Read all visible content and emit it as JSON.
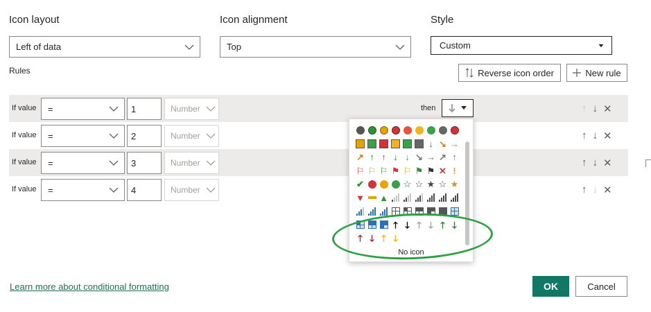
{
  "header": {
    "icon_layout_label": "Icon layout",
    "icon_layout_value": "Left of data",
    "icon_alignment_label": "Icon alignment",
    "icon_alignment_value": "Top",
    "style_label": "Style",
    "style_value": "Custom"
  },
  "rules": {
    "label": "Rules",
    "reverse_label": "Reverse icon order",
    "new_rule_label": "New rule",
    "items": [
      {
        "if_label": "If value",
        "operator": "=",
        "value": "1",
        "type": "Number",
        "then": "then"
      },
      {
        "if_label": "If value",
        "operator": "=",
        "value": "2",
        "type": "Number"
      },
      {
        "if_label": "If value",
        "operator": "=",
        "value": "3",
        "type": "Number"
      },
      {
        "if_label": "If value",
        "operator": "=",
        "value": "4",
        "type": "Number"
      }
    ]
  },
  "icon_picker": {
    "no_icon_label": "No icon"
  },
  "footer": {
    "learn_more": "Learn more about conditional formatting",
    "ok_label": "OK",
    "cancel_label": "Cancel"
  },
  "colors": {
    "accent": "#117865",
    "annotation": "#2ea043",
    "row_shade": "#edebe9"
  }
}
